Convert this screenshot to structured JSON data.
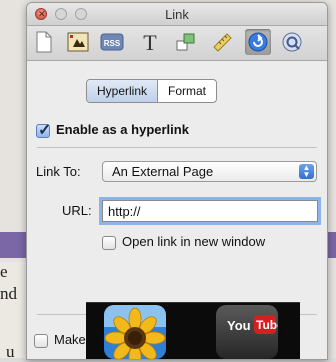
{
  "window": {
    "title": "Link"
  },
  "toolbar": {
    "items": [
      "document-icon",
      "graphic-icon",
      "rss-icon",
      "text-icon",
      "metrics-icon",
      "ruler-icon",
      "link-inspector-icon",
      "qt-icon"
    ],
    "active": "link-inspector-icon"
  },
  "tabs": {
    "hyperlink": "Hyperlink",
    "format": "Format"
  },
  "hyperlink": {
    "enable_label": "Enable as a hyperlink",
    "enabled": true,
    "link_to_label": "Link To:",
    "link_to_value": "An External Page",
    "url_label": "URL:",
    "url_value": "http://",
    "new_window_label": "Open link in new window",
    "new_window_checked": false
  },
  "bottom": {
    "make_label": "Make"
  },
  "background": {
    "letters": [
      "e",
      "nd",
      "u"
    ]
  },
  "dock": {
    "apps": [
      "Sunflower photo",
      "YouTube"
    ],
    "youtube_you": "You",
    "youtube_tube": "Tube"
  },
  "colors": {
    "focus_ring": "#8db4e8",
    "selected_tab": "#bfd0ea",
    "band": "#7b66a6"
  }
}
